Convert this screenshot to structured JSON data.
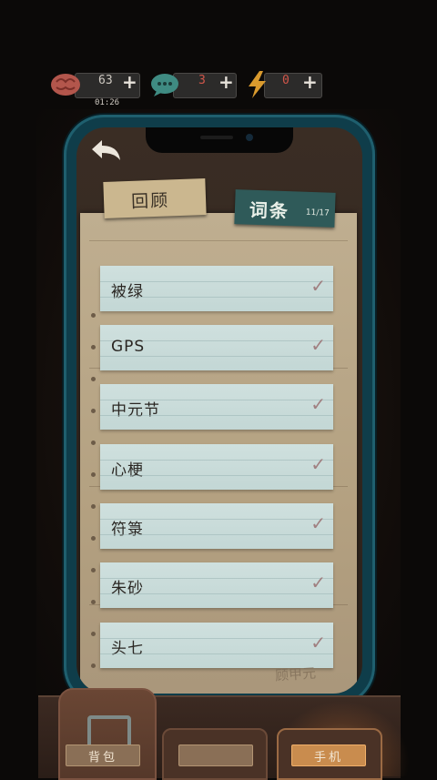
{
  "resources": {
    "brain": {
      "value": "63",
      "plus": "+"
    },
    "chat": {
      "value": "3",
      "plus": "+"
    },
    "energy": {
      "value": "0",
      "plus": "+"
    },
    "timer": "01:26"
  },
  "tabs": {
    "review": "回顾",
    "terms": "词条",
    "terms_count": "11/17"
  },
  "terms": [
    {
      "label": "被绿",
      "check": "✓"
    },
    {
      "label": "GPS",
      "check": "✓"
    },
    {
      "label": "中元节",
      "check": "✓"
    },
    {
      "label": "心梗",
      "check": "✓"
    },
    {
      "label": "符箓",
      "check": "✓"
    },
    {
      "label": "朱砂",
      "check": "✓"
    },
    {
      "label": "头七",
      "check": "✓"
    }
  ],
  "signature": "顾甲元",
  "bottom_nav": {
    "bag": "背包",
    "middle": "",
    "phone": "手机"
  },
  "colors": {
    "phone_frame": "#0f3d4a",
    "card": "#c3d7d5",
    "terms_tab": "#2f5a59",
    "active_glow": "#c98c4e"
  }
}
